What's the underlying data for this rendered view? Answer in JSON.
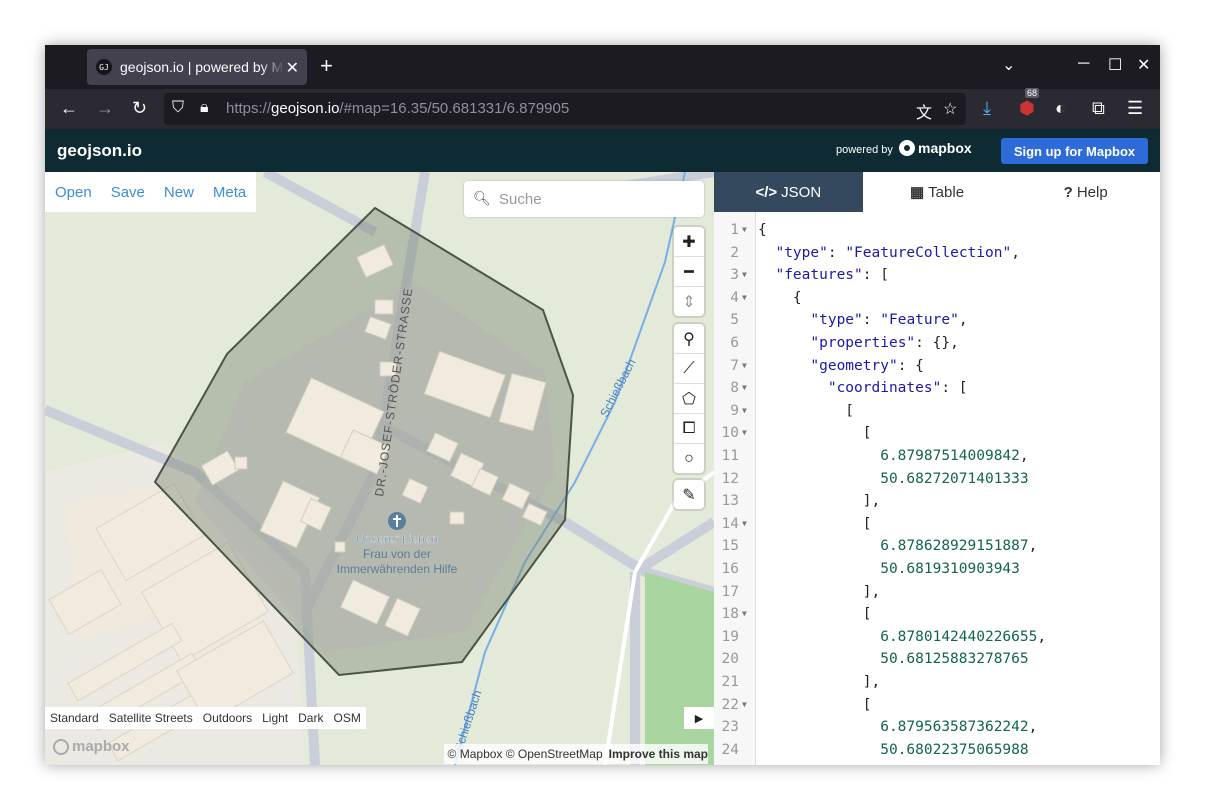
{
  "browser": {
    "tab_title": "geojson.io | powered by Mapbox",
    "tab_icon_text": "GJ",
    "url_prefix": "https://",
    "url_host": "geojson.io",
    "url_rest": "/#map=16.35/50.681331/6.879905",
    "extension_badge": "68"
  },
  "header": {
    "brand": "geojson.io",
    "powered_by": "powered by",
    "mapbox_logo": "mapbox",
    "signup": "Sign up for Mapbox"
  },
  "menu": [
    "Open",
    "Save",
    "New",
    "Meta"
  ],
  "search": {
    "placeholder": "Suche"
  },
  "map": {
    "street_label": "DR.-JOSEF-STRÖDER-STRASSE",
    "stream_label_1": "Schießbach",
    "stream_label_2": "Schießbach",
    "church_label_1": "Unserer Lieben",
    "church_label_2": "Frau von der",
    "church_label_3": "Immerwährenden Hilfe",
    "styles": [
      "Standard",
      "Satellite Streets",
      "Outdoors",
      "Light",
      "Dark",
      "OSM"
    ],
    "watermark": "mapbox",
    "attribution": "© Mapbox © OpenStreetMap",
    "improve": "Improve this map"
  },
  "panel": {
    "tabs": [
      {
        "icon": "</>",
        "label": "JSON"
      },
      {
        "icon": "▦",
        "label": "Table"
      },
      {
        "icon": "?",
        "label": "Help"
      }
    ]
  },
  "code_lines": [
    {
      "n": "1",
      "fold": true,
      "text": "{"
    },
    {
      "n": "2",
      "fold": false,
      "text": "  \"type\": \"FeatureCollection\","
    },
    {
      "n": "3",
      "fold": true,
      "text": "  \"features\": ["
    },
    {
      "n": "4",
      "fold": true,
      "text": "    {"
    },
    {
      "n": "5",
      "fold": false,
      "text": "      \"type\": \"Feature\","
    },
    {
      "n": "6",
      "fold": false,
      "text": "      \"properties\": {},"
    },
    {
      "n": "7",
      "fold": true,
      "text": "      \"geometry\": {"
    },
    {
      "n": "8",
      "fold": true,
      "text": "        \"coordinates\": ["
    },
    {
      "n": "9",
      "fold": true,
      "text": "          ["
    },
    {
      "n": "10",
      "fold": true,
      "text": "            ["
    },
    {
      "n": "11",
      "fold": false,
      "text": "              6.87987514009842,"
    },
    {
      "n": "12",
      "fold": false,
      "text": "              50.68272071401333"
    },
    {
      "n": "13",
      "fold": false,
      "text": "            ],"
    },
    {
      "n": "14",
      "fold": true,
      "text": "            ["
    },
    {
      "n": "15",
      "fold": false,
      "text": "              6.878628929151887,"
    },
    {
      "n": "16",
      "fold": false,
      "text": "              50.6819310903943"
    },
    {
      "n": "17",
      "fold": false,
      "text": "            ],"
    },
    {
      "n": "18",
      "fold": true,
      "text": "            ["
    },
    {
      "n": "19",
      "fold": false,
      "text": "              6.8780142440226655,"
    },
    {
      "n": "20",
      "fold": false,
      "text": "              50.68125883278765"
    },
    {
      "n": "21",
      "fold": false,
      "text": "            ],"
    },
    {
      "n": "22",
      "fold": true,
      "text": "            ["
    },
    {
      "n": "23",
      "fold": false,
      "text": "              6.879563587362242,"
    },
    {
      "n": "24",
      "fold": false,
      "text": "              50.68022375065988"
    }
  ]
}
